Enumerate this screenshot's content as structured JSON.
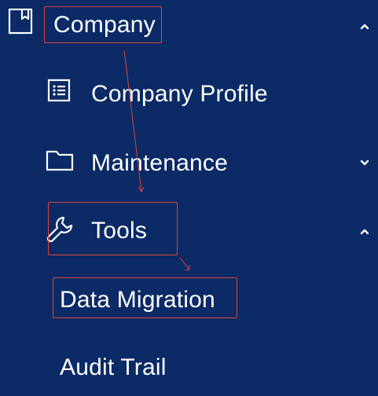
{
  "menu": {
    "company": {
      "label": "Company"
    },
    "company_profile": {
      "label": "Company Profile"
    },
    "maintenance": {
      "label": "Maintenance"
    },
    "tools": {
      "label": "Tools"
    },
    "data_migration": {
      "label": "Data Migration"
    },
    "audit_trail": {
      "label": "Audit Trail"
    }
  },
  "icons": {
    "company": "bookmark-icon",
    "company_profile": "list-icon",
    "maintenance": "folder-icon",
    "tools": "wrench-icon",
    "chevron_up": "chevron-up-icon",
    "chevron_down": "chevron-down-icon"
  },
  "colors": {
    "background": "#0b2a66",
    "text": "#ffffff",
    "annotation": "#e0453a"
  }
}
